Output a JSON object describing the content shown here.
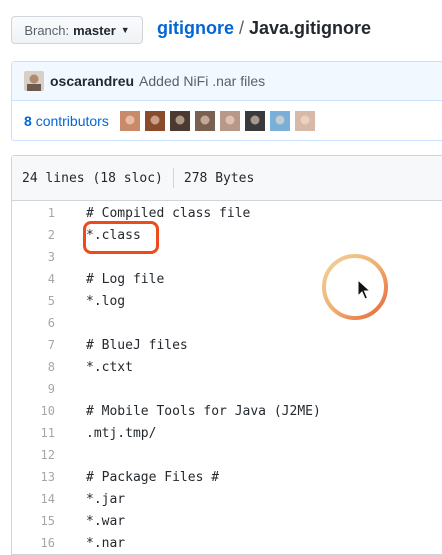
{
  "branch": {
    "label": "Branch:",
    "value": "master"
  },
  "breadcrumb": {
    "repo": "gitignore",
    "separator": "/",
    "file": "Java.gitignore"
  },
  "commit": {
    "author": "oscarandreu",
    "message": "Added NiFi .nar files"
  },
  "contributors": {
    "count": "8",
    "label": "contributors",
    "avatar_colors": [
      "#c98a6a",
      "#8a4a2c",
      "#4a3a30",
      "#7a6050",
      "#b89888",
      "#3a3a3a",
      "#7ab0d8",
      "#d8b8a8"
    ]
  },
  "file": {
    "lines_info": "24 lines (18 sloc)",
    "size": "278 Bytes",
    "lines": [
      {
        "n": "1",
        "text": "# Compiled class file"
      },
      {
        "n": "2",
        "text": "*.class"
      },
      {
        "n": "3",
        "text": ""
      },
      {
        "n": "4",
        "text": "# Log file"
      },
      {
        "n": "5",
        "text": "*.log"
      },
      {
        "n": "6",
        "text": ""
      },
      {
        "n": "7",
        "text": "# BlueJ files"
      },
      {
        "n": "8",
        "text": "*.ctxt"
      },
      {
        "n": "9",
        "text": ""
      },
      {
        "n": "10",
        "text": "# Mobile Tools for Java (J2ME)"
      },
      {
        "n": "11",
        "text": ".mtj.tmp/"
      },
      {
        "n": "12",
        "text": ""
      },
      {
        "n": "13",
        "text": "# Package Files #"
      },
      {
        "n": "14",
        "text": "*.jar"
      },
      {
        "n": "15",
        "text": "*.war"
      },
      {
        "n": "16",
        "text": "*.nar"
      }
    ]
  },
  "colors": {
    "link": "#0366d6",
    "highlight": "#ee4b1c",
    "commit_bg": "#f1f8ff"
  }
}
